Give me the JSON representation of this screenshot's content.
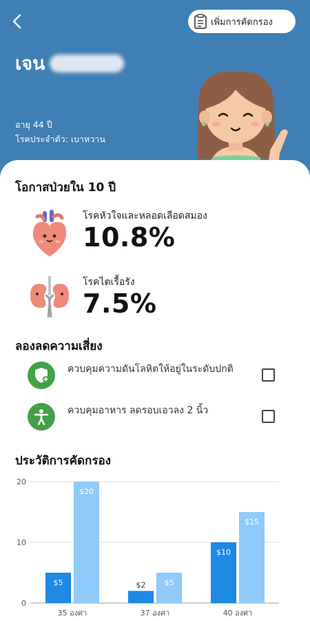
{
  "header": {
    "title": "เจน",
    "add_screening_label": "เพิ่มการคัดกรอง",
    "age": "อายุ 44 ปี",
    "condition": "โรคประจำตัว: เบาหวาน"
  },
  "risk_section": {
    "title": "โอกาสป่วยใน 10 ปี",
    "items": [
      {
        "label": "โรคหัวใจและหลอดเลือดสมอง",
        "value": "10.8%",
        "icon": "heart-icon"
      },
      {
        "label": "โรคไตเรื้อรัง",
        "value": "7.5%",
        "icon": "kidney-icon"
      }
    ]
  },
  "reduce_section": {
    "title": "ลองลดความเสี่ยง",
    "actions": [
      {
        "text": "ควบคุมความดันโลหิตให้อยู่ในระดับปกติ",
        "icon": "shield-plus-icon",
        "checked": false
      },
      {
        "text": "ควบคุมอาหาร ลดรอบเอวลง 2 นิ้ว",
        "icon": "person-icon",
        "checked": false
      }
    ]
  },
  "history_section": {
    "title": "ประวัติการคัดกรอง"
  },
  "chart_data": {
    "type": "bar",
    "categories": [
      "35 องศา",
      "37 องศา",
      "40 องศา"
    ],
    "series": [
      {
        "values": [
          5,
          2,
          10
        ],
        "labels": [
          "$5",
          "$2",
          "$10"
        ],
        "color": "#1e88e5"
      },
      {
        "values": [
          20,
          5,
          15
        ],
        "labels": [
          "$20",
          "$5",
          "$15"
        ],
        "color": "#90caf9"
      }
    ],
    "y_ticks": [
      0,
      10,
      20
    ],
    "ylim": [
      0,
      20
    ],
    "grid": true
  },
  "colors": {
    "header_bg": "#3f7fb4",
    "action_icon_bg": "#43a047"
  }
}
